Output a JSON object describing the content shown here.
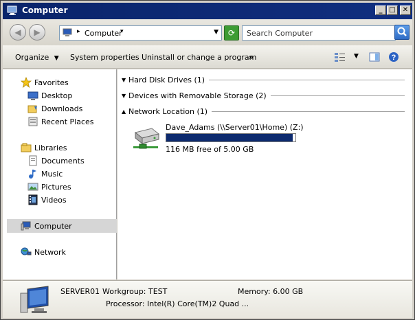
{
  "window": {
    "title": "Computer",
    "buttons": {
      "minimize": "_",
      "maximize": "□",
      "close": "✕"
    }
  },
  "address": {
    "crumb": "Computer",
    "search_placeholder": "Search Computer"
  },
  "toolbar": {
    "organize": "Organize",
    "system_properties": "System properties",
    "uninstall": "Uninstall or change a program",
    "more": "»"
  },
  "nav": {
    "favorites": "Favorites",
    "desktop": "Desktop",
    "downloads": "Downloads",
    "recent_places": "Recent Places",
    "libraries": "Libraries",
    "documents": "Documents",
    "music": "Music",
    "pictures": "Pictures",
    "videos": "Videos",
    "computer": "Computer",
    "network": "Network"
  },
  "groups": [
    {
      "label": "Hard Disk Drives (1)",
      "expanded": false
    },
    {
      "label": "Devices with Removable Storage (2)",
      "expanded": false
    },
    {
      "label": "Network Location (1)",
      "expanded": true
    }
  ],
  "drive": {
    "name": "Dave_Adams (\\\\Server01\\Home) (Z:)",
    "free_text": "116 MB free of 5.00 GB",
    "used_fraction": 0.977
  },
  "details": {
    "computer_name": "SERVER01",
    "workgroup": "Workgroup: TEST",
    "memory": "Memory: 6.00 GB",
    "processor": "Processor: Intel(R) Core(TM)2 Quad ..."
  },
  "colors": {
    "titlebar": "#0a246a",
    "capacity_fill": "#0d2a6e",
    "selected_nav": "#d6d6d6"
  }
}
